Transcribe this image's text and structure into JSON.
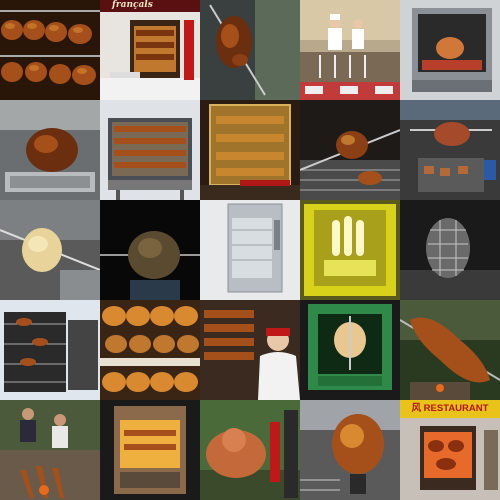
{
  "grid": {
    "rows": 5,
    "cols": 5
  },
  "signs": {
    "top_banner": "françals",
    "restaurant": "风 RESTAURANT"
  },
  "palette": {
    "roast_dark": "#6b2e0e",
    "roast_mid": "#a5501a",
    "roast_light": "#d9892f",
    "steel": "#9aa2a8",
    "green_oven": "#2f8a4a",
    "yellow_oven": "#d8d21a"
  }
}
